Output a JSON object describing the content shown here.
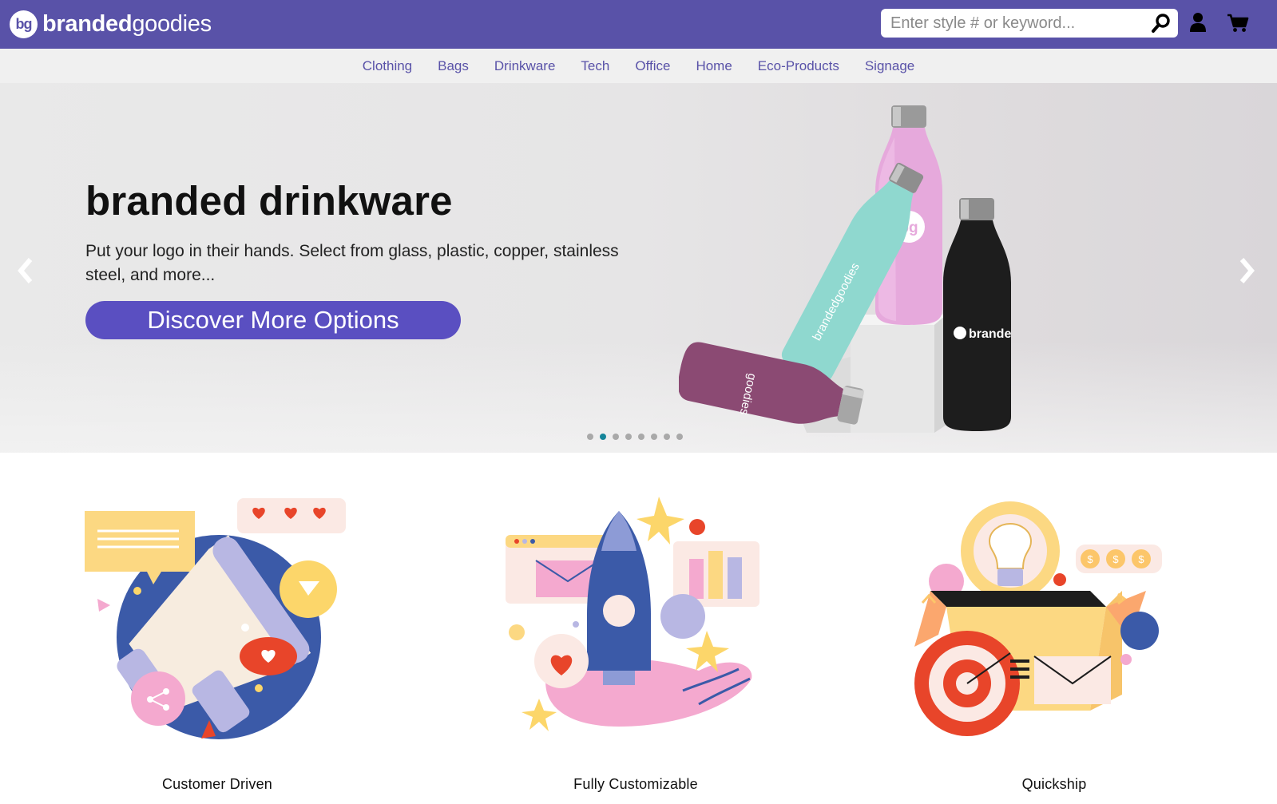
{
  "brand": {
    "badge": "bg",
    "name_bold": "branded",
    "name_light": "goodies"
  },
  "search": {
    "placeholder": "Enter style # or keyword...",
    "value": ""
  },
  "header_icons": [
    "search-icon",
    "user-icon",
    "cart-icon"
  ],
  "nav": {
    "items": [
      {
        "label": "Clothing"
      },
      {
        "label": "Bags"
      },
      {
        "label": "Drinkware"
      },
      {
        "label": "Tech"
      },
      {
        "label": "Office"
      },
      {
        "label": "Home"
      },
      {
        "label": "Eco-Products"
      },
      {
        "label": "Signage"
      }
    ]
  },
  "hero": {
    "title_light": "branded",
    "title_bold": "drinkware",
    "subtitle": "Put your logo in their hands. Select from glass, plastic, copper, stainless steel, and more...",
    "cta": "Discover More Options",
    "bottle_print_badge": "bg",
    "bottle_print_text_1": "brandedgoodies",
    "bottle_print_text_2": "brande",
    "bottle_print_text_3": "goodies",
    "slide_count": 8,
    "active_slide": 2
  },
  "features": [
    {
      "label": "Customer Driven"
    },
    {
      "label": "Fully Customizable"
    },
    {
      "label": "Quickship"
    }
  ],
  "colors": {
    "brand_purple": "#5952a8",
    "cta_purple": "#5a4fc1",
    "nav_bg": "#f0f0f0",
    "active_dot": "#15859a"
  }
}
